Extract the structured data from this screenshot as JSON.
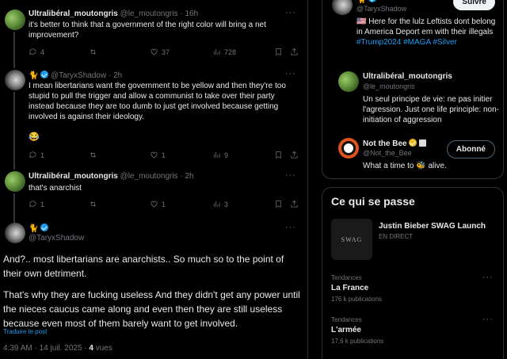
{
  "tweets": [
    {
      "name": "Ultralibéral_moutongris",
      "handle": "@le_moutongris · 16h",
      "text": "it's better to think that a government of the right color will bring a net improvement?",
      "replies": "4",
      "retweets": "",
      "likes": "37",
      "views": "728"
    },
    {
      "name": "🐈",
      "handle": "@TaryxShadow · 2h",
      "text": "I mean libertarians want the government to be yellow and then they're too stupid to pull the trigger and allow a communist to take over their party instead because they are too dumb to just get involved because getting involved is against their ideology.",
      "emoji": "😂",
      "replies": "1",
      "retweets": "",
      "likes": "1",
      "views": "9"
    },
    {
      "name": "Ultralibéral_moutongris",
      "handle": "@le_moutongris · 2h",
      "text": "that's anarchist",
      "replies": "1",
      "retweets": "",
      "likes": "1",
      "views": "3"
    }
  ],
  "focus": {
    "name": "🐈",
    "handle": "@TaryxShadow",
    "p1": "And?.. most libertarians are anarchists.. So much so to the point of their own detriment.",
    "p2": "That's why they are fucking useless And they didn't get any power until the nieces caucus came along and even then they are still useless because even most of them barely want to get involved.",
    "translate": "Traduire le post",
    "time": "4:39 AM · 14 juil. 2025 · ",
    "views_count": "4",
    "views_label": " vues"
  },
  "who_to_follow": [
    {
      "name": "🐈",
      "handle": "@TaryxShadow",
      "bio_prefix": "🇺🇸 Here for the lulz Leftists dont belong in America Deport em with their illegals ",
      "bio_tags": "#Trump2024 #MAGA #Silver",
      "button": "Suivre"
    },
    {
      "name": "Ultralibéral_moutongris",
      "handle": "@le_moutongris",
      "bio": "Un seul principe de vie: ne pas initier l'agression. Just one life principle: non-initiation of aggression",
      "button": ""
    },
    {
      "name": "Not the Bee",
      "handle": "@Not_the_Bee",
      "bio": "What a time to 🐝 alive.",
      "button": "Abonné"
    }
  ],
  "trends": {
    "title": "Ce qui se passe",
    "live": {
      "logo": "SWAG",
      "name": "Justin Bieber SWAG Launch",
      "status": "EN DIRECT"
    },
    "items": [
      {
        "label": "Tendances",
        "name": "La France",
        "count": "176 k publications"
      },
      {
        "label": "Tendances",
        "name": "L'armée",
        "count": "17,6 k publications"
      }
    ]
  }
}
